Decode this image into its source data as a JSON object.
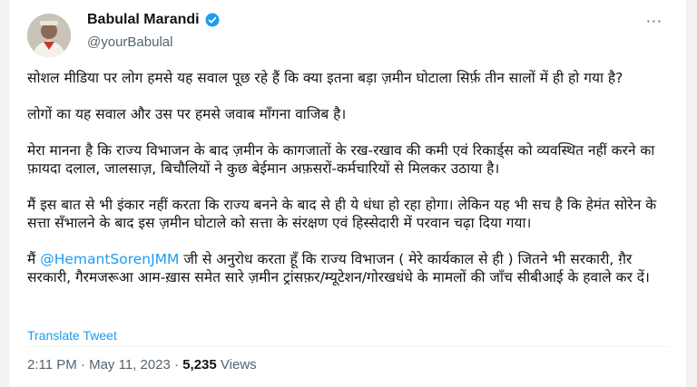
{
  "author": {
    "name": "Babulal Marandi",
    "handle": "@yourBabulal"
  },
  "tweet": {
    "p1": "सोशल मीडिया पर लोग हमसे यह सवाल पूछ रहे हैं कि क्या इतना बड़ा ज़मीन घोटाला सिर्फ़ तीन सालों में ही हो गया है?",
    "p2": "लोगों का यह सवाल और उस पर हमसे जवाब माँगना वाजिब है।",
    "p3": "मेरा मानना है कि राज्य विभाजन के बाद ज़मीन के कागजातों के रख-रखाव की कमी एवं रिकार्ड्स को व्यवस्थित नहीं करने का फ़ायदा दलाल, जालसाज़, बिचौलियों ने कुछ बेईमान अफ़सरों-कर्मचारियों से मिलकर उठाया है।",
    "p4": "मैं इस बात से भी इंकार नहीं करता कि राज्य बनने के बाद से ही ये धंधा हो रहा होगा। लेकिन यह भी सच है कि हेमंत सोरेन के सत्ता सँभालने के बाद इस ज़मीन घोटाले को सत्ता के संरक्षण एवं हिस्सेदारी में परवान चढ़ा दिया गया।",
    "p5_prefix": "मैं ",
    "p5_mention": "@HemantSorenJMM",
    "p5_rest": " जी से अनुरोध करता हूँ कि राज्य विभाजन ( मेरे कार्यकाल से ही ) जितने भी सरकारी, ग़ैर सरकारी, गैरमजरूआ आम-ख़ास समेत सारे ज़मीन ट्रांसफ़र/म्यूटेशन/गोरखधंधे के मामलों की जाँच सीबीआई के हवाले कर दें।"
  },
  "translate_label": "Translate Tweet",
  "meta": {
    "time_date": "2:11 PM · May 11, 2023 · ",
    "views_count": "5,235",
    "views_label": " Views"
  },
  "more_label": "···",
  "colors": {
    "link": "#1d9bf0",
    "verified": "#1d9bf0"
  }
}
